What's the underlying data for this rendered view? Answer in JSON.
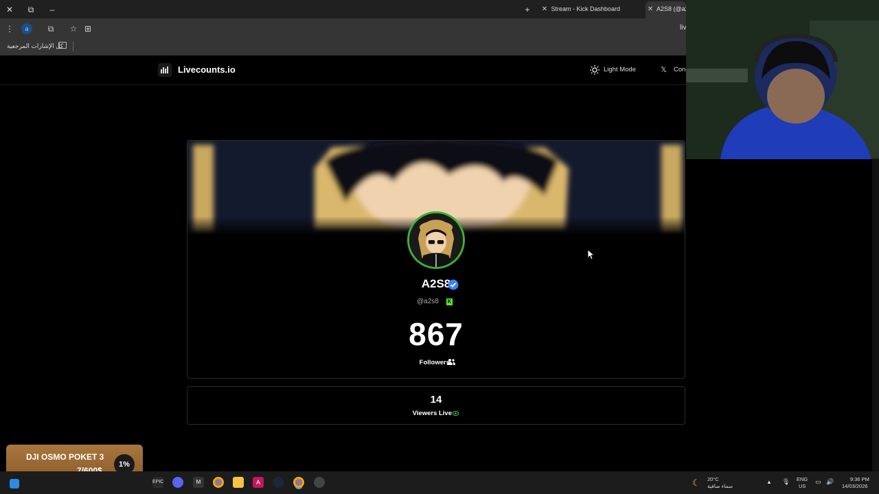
{
  "browser": {
    "tabs": [
      {
        "label": "Stream - Kick Dashboard",
        "active": false
      },
      {
        "label": "A2S8 (@a2",
        "active": true
      }
    ],
    "omnibox_text": "liv",
    "bookmarks_all_label": "كل الإشارات المرجعية",
    "profile_initial": "a"
  },
  "site": {
    "logo_text": "Livecounts.io",
    "light_mode_label": "Light Mode",
    "contact_label_partial": "Con"
  },
  "profile": {
    "name": "A2S8",
    "handle": "@a2s8",
    "platform_badge": "K",
    "follower_count": "867",
    "followers_label": "Followers",
    "viewers_count": "14",
    "viewers_label": "Viewers Live"
  },
  "donation_goal": {
    "title": "DJI OSMO POKET 3",
    "amount": "7/600$",
    "percent": "1%",
    "progress": 0.01
  },
  "taskbar": {
    "temperature": "20°C",
    "weather_desc": "سماء صافية",
    "lang_top": "ENG",
    "lang_bottom": "US",
    "time": "9:36 PM",
    "date": "14/03/2026"
  },
  "colors": {
    "accent_green": "#53fc18",
    "verified_blue": "#3b82f6",
    "goal_bg": "#9a6a32",
    "avatar_ring": "#3fae3a"
  }
}
